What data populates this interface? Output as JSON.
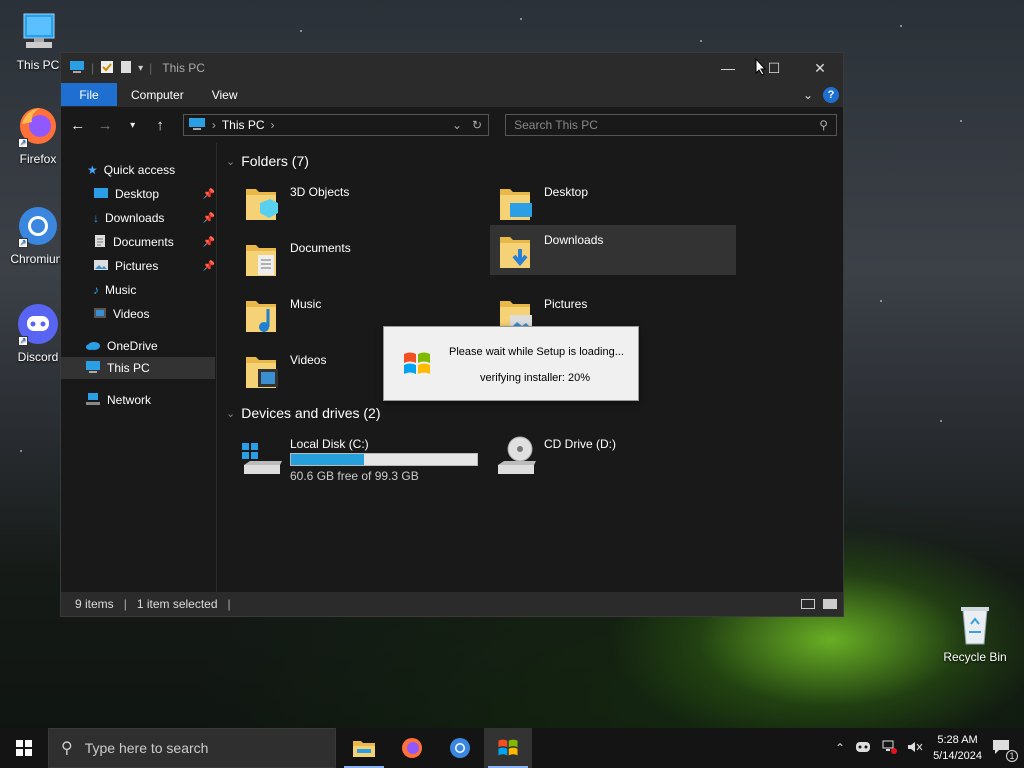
{
  "desktop": {
    "icons": [
      {
        "label": "This PC"
      },
      {
        "label": "Firefox"
      },
      {
        "label": "Chromium"
      },
      {
        "label": "Discord"
      },
      {
        "label": "Recycle Bin"
      }
    ]
  },
  "window": {
    "title": "This PC",
    "ribbon_tabs": [
      "File",
      "Computer",
      "View"
    ],
    "help_label": "?",
    "address_path": "This PC",
    "search_placeholder": "Search This PC",
    "sidebar": {
      "quick_access": "Quick access",
      "items": [
        {
          "label": "Desktop",
          "pinned": true
        },
        {
          "label": "Downloads",
          "pinned": true
        },
        {
          "label": "Documents",
          "pinned": true
        },
        {
          "label": "Pictures",
          "pinned": true
        },
        {
          "label": "Music",
          "pinned": false
        },
        {
          "label": "Videos",
          "pinned": false
        }
      ],
      "onedrive": "OneDrive",
      "this_pc": "This PC",
      "network": "Network"
    },
    "folders_header": "Folders (7)",
    "folders": [
      {
        "name": "3D Objects"
      },
      {
        "name": "Desktop"
      },
      {
        "name": "Documents"
      },
      {
        "name": "Downloads",
        "selected": true
      },
      {
        "name": "Music"
      },
      {
        "name": "Pictures"
      },
      {
        "name": "Videos"
      }
    ],
    "drives_header": "Devices and drives (2)",
    "drives": [
      {
        "name": "Local Disk (C:)",
        "free_text": "60.6 GB free of 99.3 GB",
        "used_fraction": 0.39
      },
      {
        "name": "CD Drive (D:)"
      }
    ],
    "status": {
      "items": "9 items",
      "selected": "1 item selected"
    }
  },
  "dialog": {
    "message": "Please wait while Setup is loading...",
    "status": "verifying installer: 20%"
  },
  "taskbar": {
    "search_placeholder": "Type here to search",
    "time": "5:28 AM",
    "date": "5/14/2024",
    "notification_count": "1"
  },
  "colors": {
    "accent": "#1f6fd0",
    "drive_bar": "#26a0da",
    "window_bg": "#191919"
  }
}
